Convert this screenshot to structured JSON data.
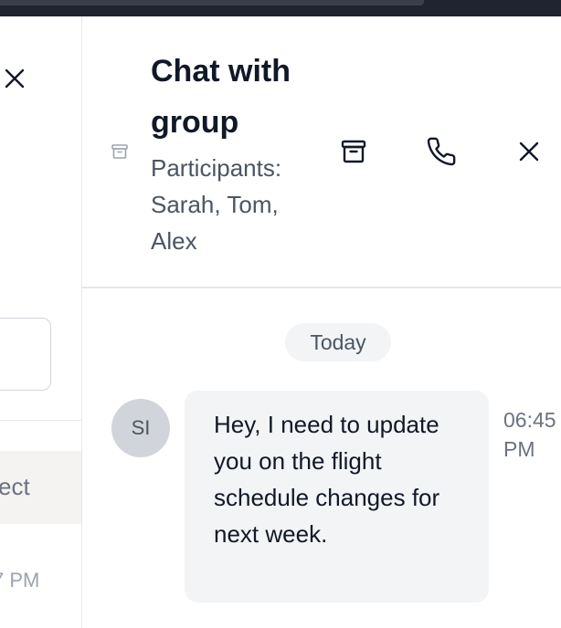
{
  "left_panel": {
    "chip_label": "ect",
    "time": "7 PM"
  },
  "header": {
    "title": "Chat with group",
    "subtitle": "Participants: Sarah, Tom, Alex",
    "icons": {
      "group": "archive-icon",
      "archive": "archive-icon",
      "call": "phone-icon",
      "close": "close-icon"
    }
  },
  "messages": {
    "date_separator": "Today",
    "items": [
      {
        "avatar_initials": "SI",
        "text": "Hey, I need to update you on the flight schedule changes for next week.",
        "time": "06:45 PM"
      }
    ]
  },
  "colors": {
    "topbar": "#1f2430",
    "bubble": "#f3f4f6",
    "avatar": "#d1d5db",
    "text": "#111827",
    "muted": "#4b5563"
  }
}
